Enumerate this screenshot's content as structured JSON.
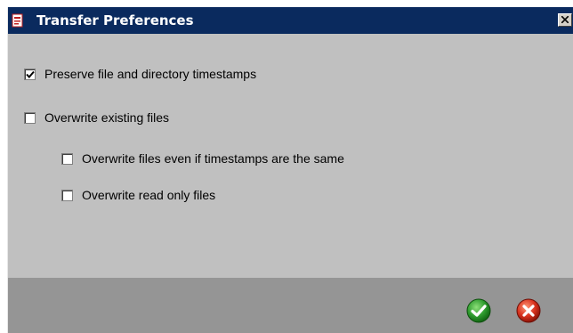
{
  "window": {
    "title": "Transfer Preferences",
    "close_glyph": "close-icon"
  },
  "options": {
    "preserve_timestamps": {
      "label": "Preserve file and directory timestamps",
      "checked": true
    },
    "overwrite_existing": {
      "label": "Overwrite existing files",
      "checked": false
    },
    "overwrite_same_timestamps": {
      "label": "Overwrite files even if timestamps are the same",
      "checked": false
    },
    "overwrite_read_only": {
      "label": "Overwrite read only files",
      "checked": false
    }
  },
  "actions": {
    "ok_icon": "green-check-icon",
    "cancel_icon": "red-x-icon"
  },
  "colors": {
    "titlebar": "#0a2a5e",
    "dialog_bg": "#c0c0c0",
    "footer_bg": "#959595",
    "ok_green": "#2e9b2e",
    "cancel_red": "#d8321e"
  }
}
